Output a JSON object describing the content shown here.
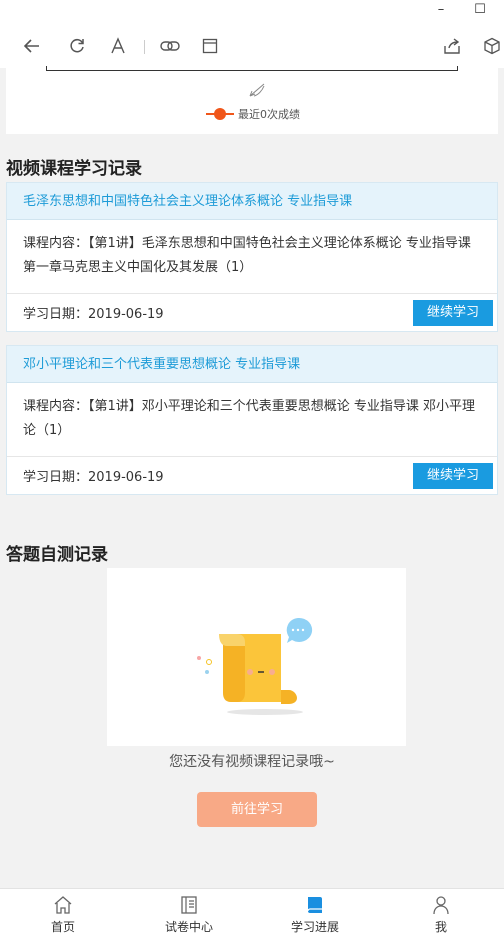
{
  "window": {
    "minimize_glyph": "–",
    "maximize_glyph": "☐"
  },
  "toolbar": {
    "icons": [
      "back-arrow-icon",
      "refresh-icon",
      "font-icon",
      "link-icon",
      "window-icon",
      "share-icon",
      "cube-icon"
    ]
  },
  "chart": {
    "legend_label": "最近0次成绩",
    "series_color": "#f0561a"
  },
  "video_section": {
    "title": "视频课程学习记录",
    "cards": [
      {
        "title": "毛泽东思想和中国特色社会主义理论体系概论 专业指导课",
        "content": "课程内容：【第1讲】毛泽东思想和中国特色社会主义理论体系概论 专业指导课 第一章马克思主义中国化及其发展（1）",
        "date": "学习日期：2019-06-19",
        "button": "继续学习"
      },
      {
        "title": "邓小平理论和三个代表重要思想概论 专业指导课",
        "content": "课程内容：【第1讲】邓小平理论和三个代表重要思想概论 专业指导课 邓小平理论（1）",
        "date": "学习日期：2019-06-19",
        "button": "继续学习"
      }
    ]
  },
  "quiz_section": {
    "title": "答题自测记录",
    "empty_text": "您还没有视频课程记录哦~",
    "go_button": "前往学习"
  },
  "tabs": [
    {
      "label": "首页",
      "icon": "home-icon",
      "active": false
    },
    {
      "label": "试卷中心",
      "icon": "paper-icon",
      "active": false
    },
    {
      "label": "学习进展",
      "icon": "book-icon",
      "active": true
    },
    {
      "label": "我",
      "icon": "user-icon",
      "active": false
    }
  ],
  "colors": {
    "accent": "#1a9be0",
    "go_button": "#f8a986",
    "tab_active": "#1a8fe0"
  }
}
